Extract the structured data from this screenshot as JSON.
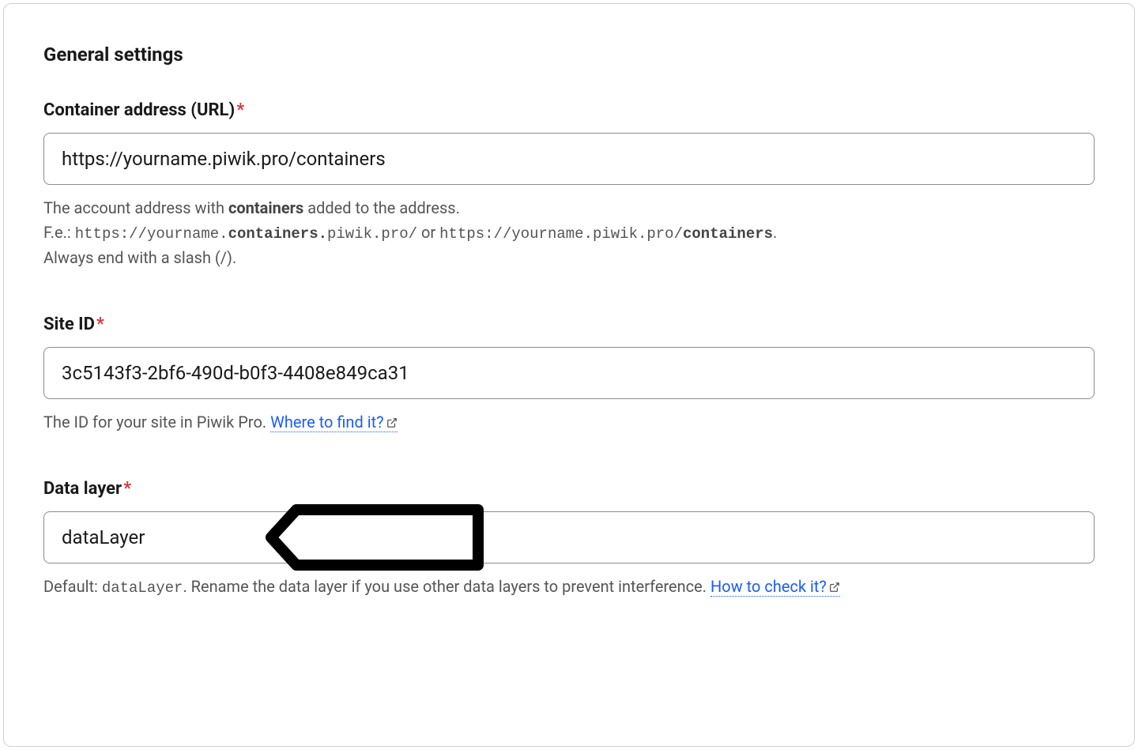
{
  "section_title": "General settings",
  "fields": {
    "container_address": {
      "label": "Container address (URL)",
      "required_mark": "*",
      "value": "https://yourname.piwik.pro/containers",
      "help_prefix": "The account address with ",
      "help_bold1": "containers",
      "help_mid1": " added to the address.",
      "help_line2_prefix": "F.e.: ",
      "help_mono1_a": "https://yourname.",
      "help_mono1_b": "containers.",
      "help_mono1_c": "piwik.pro/",
      "help_or": " or ",
      "help_mono2_a": "https://yourname.piwik.pro/",
      "help_mono2_b": "containers",
      "help_mono2_c": ".",
      "help_line3": "Always end with a slash (/)."
    },
    "site_id": {
      "label": "Site ID",
      "required_mark": "*",
      "value": "3c5143f3-2bf6-490d-b0f3-4408e849ca31",
      "help_prefix": "The ID for your site in Piwik Pro. ",
      "link_text": "Where to find it?"
    },
    "data_layer": {
      "label": "Data layer",
      "required_mark": "*",
      "value": "dataLayer",
      "help_prefix": "Default: ",
      "help_mono": "dataLayer",
      "help_mid": ". Rename the data layer if you use other data layers to prevent interference. ",
      "link_text": "How to check it?"
    }
  }
}
